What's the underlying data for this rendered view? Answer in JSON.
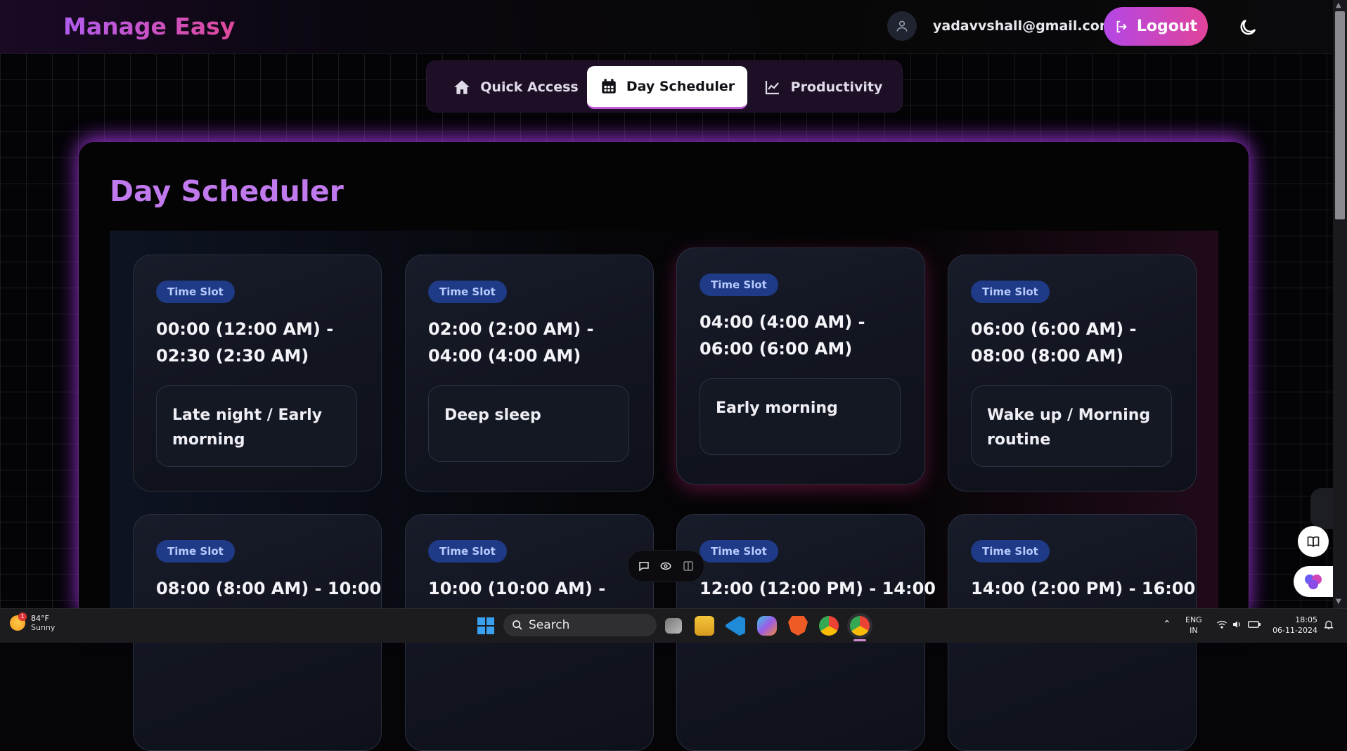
{
  "header": {
    "brand": "Manage Easy",
    "user_email": "yadavvshall@gmail.com",
    "logout_label": "Logout",
    "accent_gradient": [
      "#b447e6",
      "#e0439a"
    ]
  },
  "tabs": [
    {
      "label": "Quick Access",
      "icon": "home-icon",
      "active": false
    },
    {
      "label": "Day Scheduler",
      "icon": "calendar-icon",
      "active": true
    },
    {
      "label": "Productivity",
      "icon": "chart-line-icon",
      "active": false
    }
  ],
  "panel": {
    "title": "Day Scheduler",
    "title_color": "#c179ee"
  },
  "slots": [
    {
      "badge": "Time Slot",
      "time": "00:00 (12:00 AM) - 02:30 (2:30 AM)",
      "desc": "Late night / Early morning"
    },
    {
      "badge": "Time Slot",
      "time": "02:00 (2:00 AM) - 04:00 (4:00 AM)",
      "desc": "Deep sleep"
    },
    {
      "badge": "Time Slot",
      "time": "04:00 (4:00 AM) - 06:00 (6:00 AM)",
      "desc": "Early morning"
    },
    {
      "badge": "Time Slot",
      "time": "06:00 (6:00 AM) - 08:00 (8:00 AM)",
      "desc": "Wake up / Morning routine"
    },
    {
      "badge": "Time Slot",
      "time": "08:00 (8:00 AM) - 10:00"
    },
    {
      "badge": "Time Slot",
      "time": "10:00 (10:00 AM) -"
    },
    {
      "badge": "Time Slot",
      "time": "12:00 (12:00 PM) - 14:00"
    },
    {
      "badge": "Time Slot",
      "time": "14:00 (2:00 PM) - 16:00"
    }
  ],
  "taskbar": {
    "weather_temp": "84°F",
    "weather_cond": "Sunny",
    "weather_badge": "1",
    "search_label": "Search",
    "lang_top": "ENG",
    "lang_bottom": "IN",
    "time": "18:05",
    "date": "06-11-2024"
  }
}
